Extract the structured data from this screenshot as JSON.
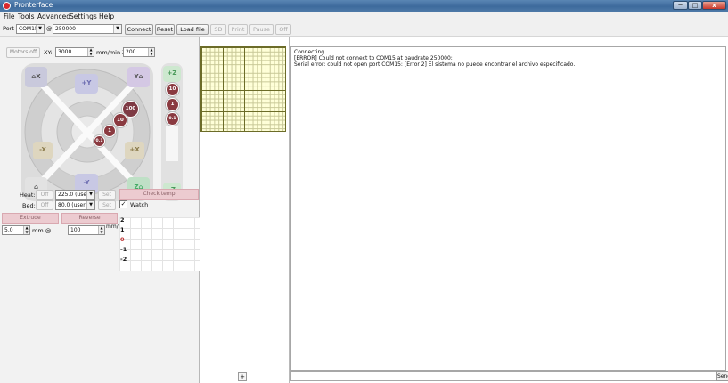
{
  "window": {
    "title": "Pronterface",
    "minimize": "─",
    "maximize": "□",
    "close": "x"
  },
  "menu": {
    "items": [
      "File",
      "Tools",
      "Advanced",
      "Settings",
      "Help"
    ]
  },
  "toolbar": {
    "port_label": "Port",
    "port_value": "COM15",
    "at_label": "@",
    "baud_value": "250000",
    "connect": "Connect",
    "reset": "Reset",
    "load_file": "Load file",
    "sd": "SD",
    "print": "Print",
    "pause": "Pause",
    "off": "Off"
  },
  "motion": {
    "motors_off": "Motors off",
    "xy_label": "XY:",
    "xy_feed": "3000",
    "units_label": "mm/min Z:",
    "z_feed": "200"
  },
  "jog": {
    "home_x": "X",
    "home_y": "Y",
    "home_z": "Z",
    "minus_x": "-X",
    "plus_x": "+X",
    "plus_y": "+Y",
    "minus_y": "-Y",
    "steps": [
      "100",
      "10",
      "1",
      "0.1"
    ],
    "plus_z": "+Z",
    "minus_z": "-Z",
    "z_steps": [
      "10",
      "1",
      "0.1"
    ]
  },
  "temp": {
    "heat_label": "Heat:",
    "heat_off": "Off",
    "heat_value": "225.0 (user)",
    "heat_set": "Set",
    "bed_label": "Bed:",
    "bed_off": "Off",
    "bed_value": "80.0 (user)",
    "bed_set": "Set",
    "check_temp": "Check temp",
    "watch_label": "Watch",
    "watch_checked": true
  },
  "extrude": {
    "extrude": "Extrude",
    "reverse": "Reverse",
    "length": "5.0",
    "mm_label": "mm @",
    "speed": "100",
    "units_label": "mm/min"
  },
  "graph": {
    "y_labels": [
      "2",
      "1",
      "0",
      "-1",
      "-2"
    ]
  },
  "preview": {
    "layer_button": "+"
  },
  "log": {
    "lines": [
      "Connecting...",
      "[ERROR] Could not connect to COM15 at baudrate 250000:",
      "Serial error: could not open port COM15: [Error 2] El sistema no puede encontrar el archivo especificado."
    ],
    "send": "Send"
  }
}
